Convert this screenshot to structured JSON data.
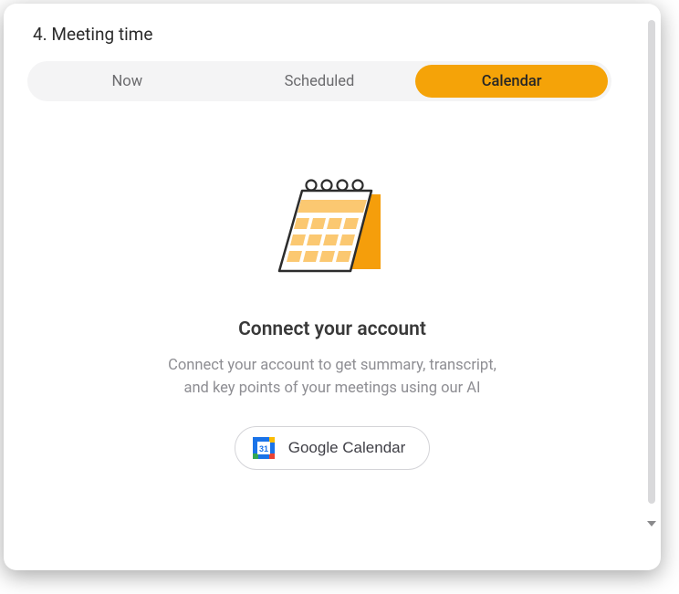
{
  "section": {
    "title": "4. Meeting time"
  },
  "tabs": {
    "now": "Now",
    "scheduled": "Scheduled",
    "calendar": "Calendar"
  },
  "connect": {
    "title": "Connect your account",
    "description": "Connect your account to get summary, transcript, and key points of your meetings using our AI",
    "button_label": "Google Calendar",
    "icon_day": "31"
  }
}
